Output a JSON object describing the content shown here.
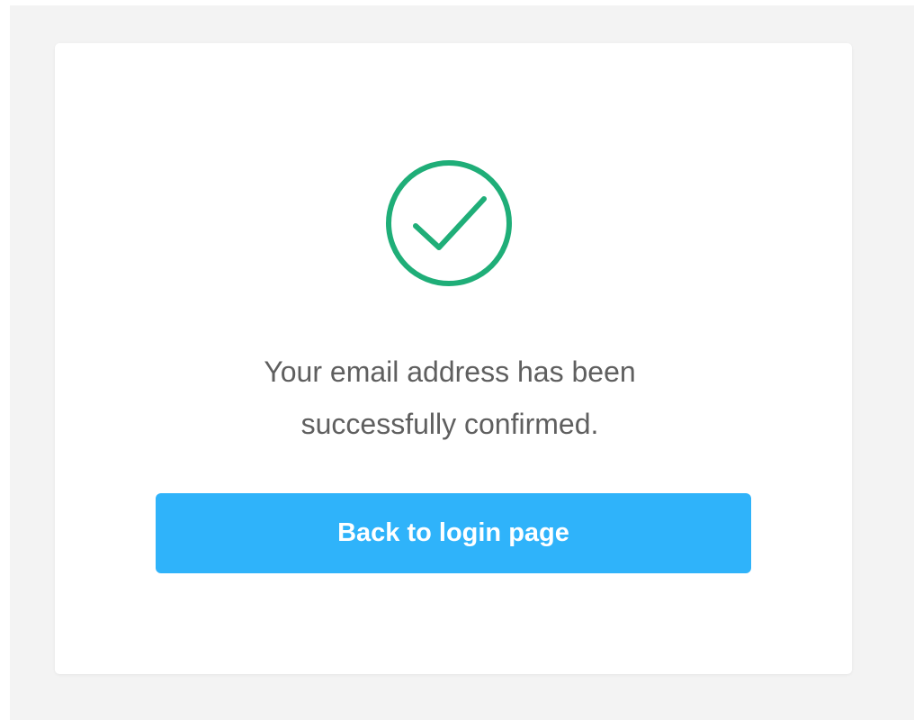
{
  "confirmation": {
    "icon": "check-circle-icon",
    "message_line1": "Your email address has been",
    "message_line2": "successfully confirmed.",
    "button_label": "Back to login page"
  },
  "colors": {
    "page_background": "#f3f3f3",
    "card_background": "#ffffff",
    "success_green": "#1fae78",
    "text_gray": "#5f5f5f",
    "primary_button": "#2fb3fa",
    "button_text": "#ffffff"
  }
}
